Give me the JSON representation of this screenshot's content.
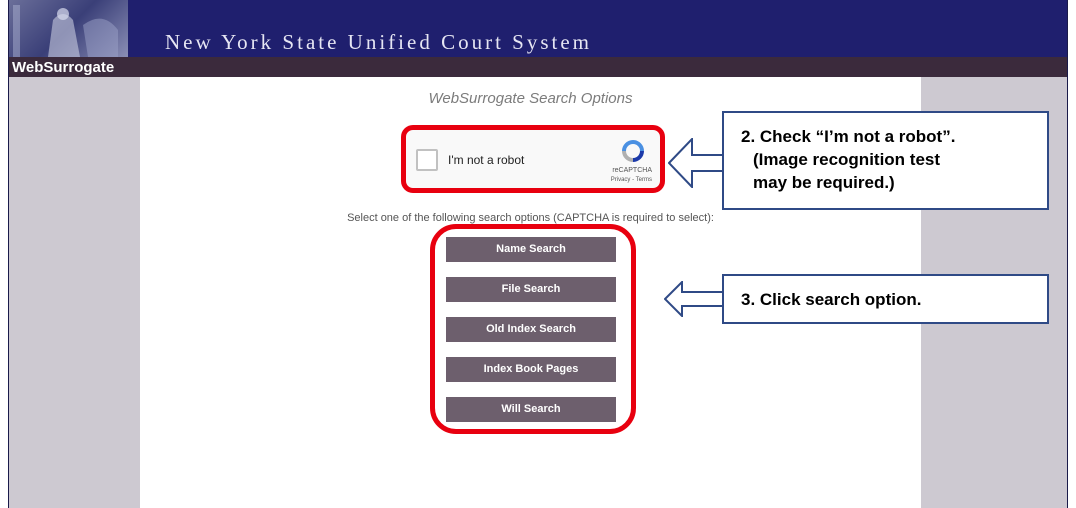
{
  "header": {
    "title": "New York State Unified Court System",
    "app_name": "WebSurrogate"
  },
  "main": {
    "title": "WebSurrogate Search Options",
    "captcha": {
      "checkbox_label": "I'm not a robot",
      "brand": "reCAPTCHA",
      "links": "Privacy - Terms"
    },
    "instruction": "Select one of the following search options (CAPTCHA is required to select):",
    "buttons": [
      "Name Search",
      "File Search",
      "Old Index Search",
      "Index Book Pages",
      "Will Search"
    ]
  },
  "annotations": {
    "step2": [
      "2. Check “I’m not a robot”.",
      "(Image recognition test",
      "may be required.)"
    ],
    "step3": "3. Click search option."
  },
  "colors": {
    "banner": "#1f1f6e",
    "subbar": "#3b2a3c",
    "sidebar": "#cdc9d1",
    "button": "#6d5f6d",
    "highlight": "#e8000f",
    "callout_border": "#2f4a86"
  },
  "icons": [
    "court-seal-logo",
    "recaptcha-icon",
    "arrow-left-icon"
  ]
}
